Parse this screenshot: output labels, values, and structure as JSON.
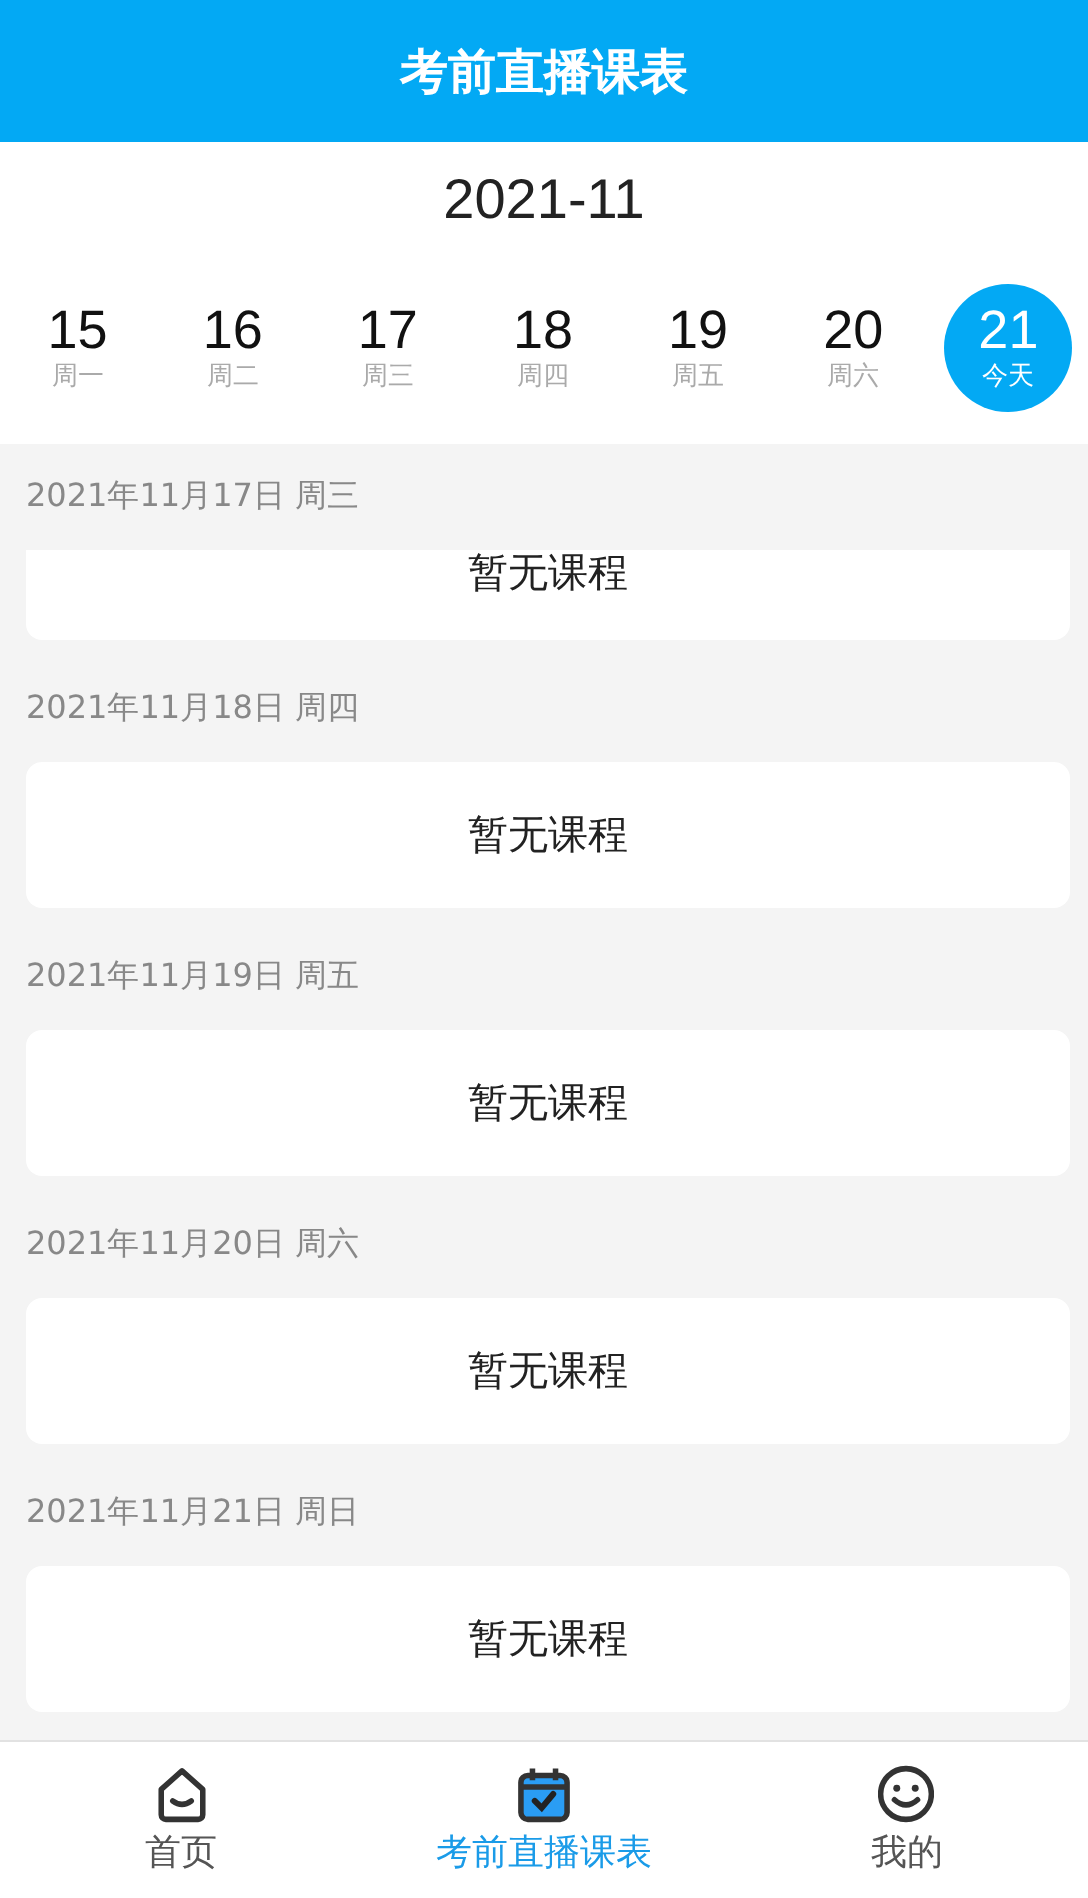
{
  "header": {
    "title": "考前直播课表"
  },
  "month": "2021-11",
  "days": [
    {
      "number": "15",
      "label": "周一",
      "selected": false
    },
    {
      "number": "16",
      "label": "周二",
      "selected": false
    },
    {
      "number": "17",
      "label": "周三",
      "selected": false
    },
    {
      "number": "18",
      "label": "周四",
      "selected": false
    },
    {
      "number": "19",
      "label": "周五",
      "selected": false
    },
    {
      "number": "20",
      "label": "周六",
      "selected": false
    },
    {
      "number": "21",
      "label": "今天",
      "selected": true
    }
  ],
  "sections": [
    {
      "date": "2021年11月17日 周三",
      "message": "暂无课程"
    },
    {
      "date": "2021年11月18日 周四",
      "message": "暂无课程"
    },
    {
      "date": "2021年11月19日 周五",
      "message": "暂无课程"
    },
    {
      "date": "2021年11月20日 周六",
      "message": "暂无课程"
    },
    {
      "date": "2021年11月21日 周日",
      "message": "暂无课程"
    }
  ],
  "nav": [
    {
      "label": "首页",
      "selected": false
    },
    {
      "label": "考前直播课表",
      "selected": true
    },
    {
      "label": "我的",
      "selected": false
    }
  ]
}
